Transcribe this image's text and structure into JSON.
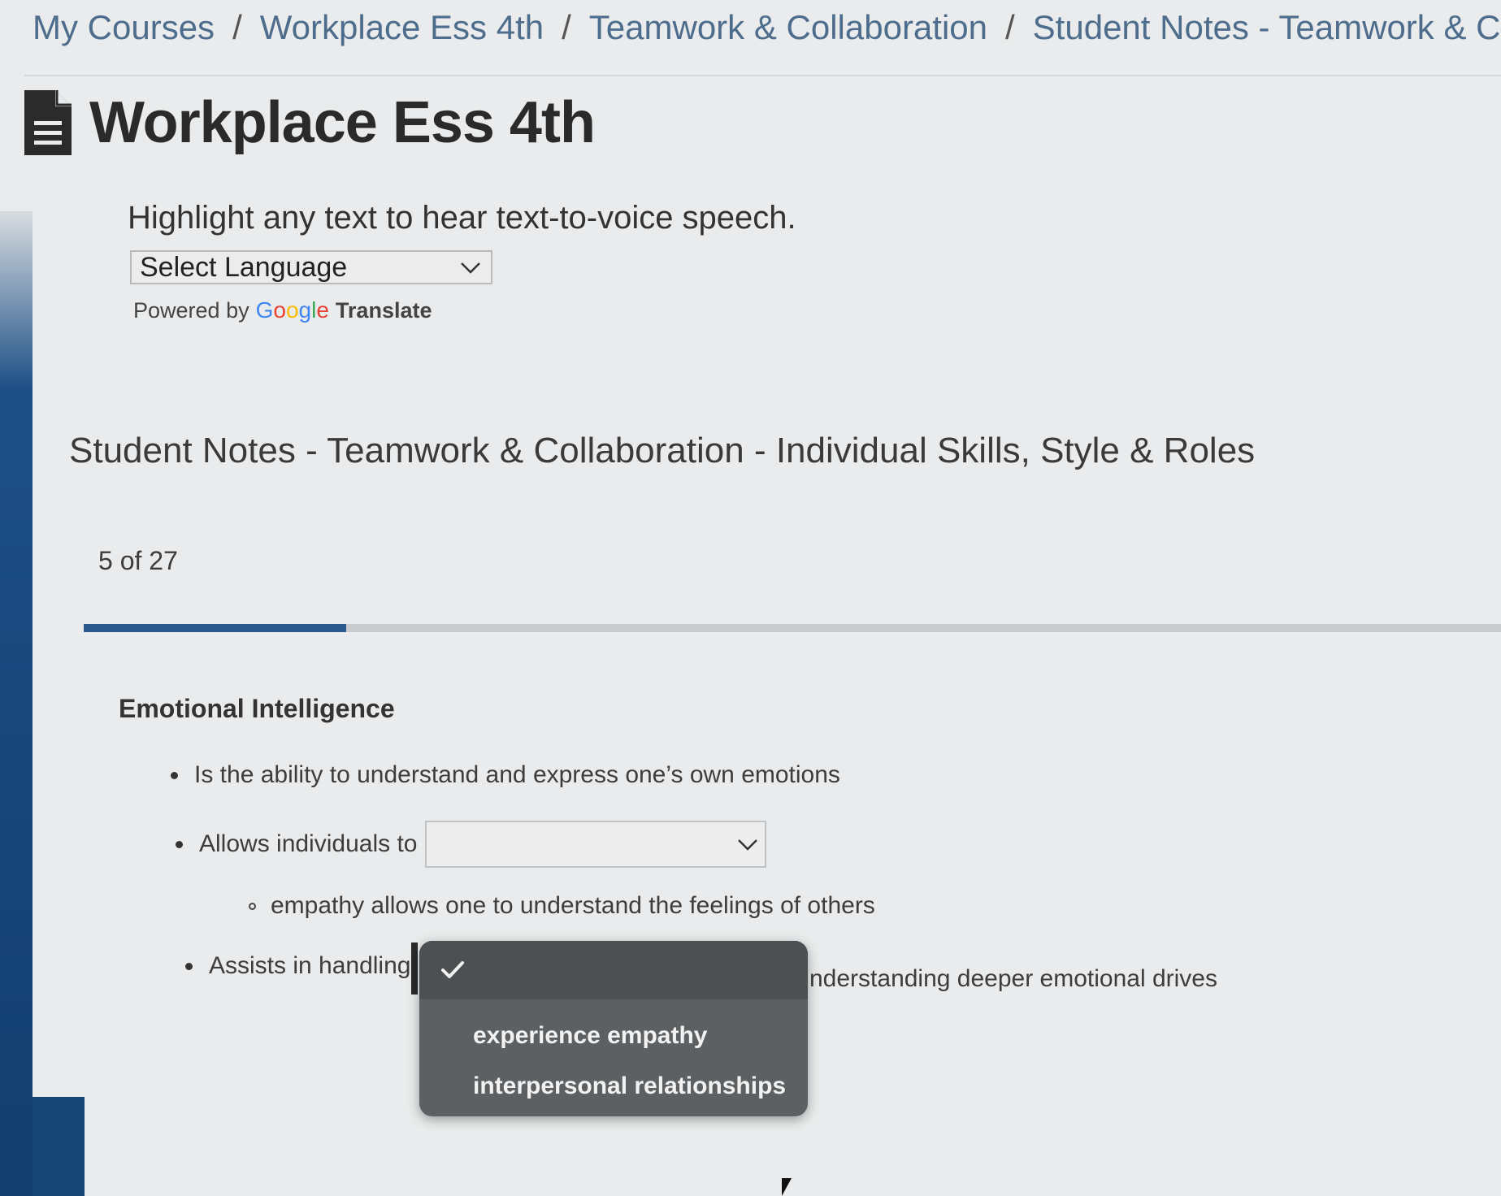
{
  "breadcrumb": {
    "items": [
      {
        "label": "My Courses"
      },
      {
        "label": "Workplace Ess 4th"
      },
      {
        "label": "Teamwork & Collaboration"
      },
      {
        "label": "Student Notes - Teamwork & Collabora"
      }
    ],
    "separator": "/"
  },
  "course": {
    "title": "Workplace Ess 4th",
    "icon": "document-icon"
  },
  "translate": {
    "hint": "Highlight any text to hear text-to-voice speech.",
    "select_label": "Select Language",
    "powered_by": "Powered by",
    "google_letters": [
      "G",
      "o",
      "o",
      "g",
      "l",
      "e"
    ],
    "translate_label": "Translate"
  },
  "lesson": {
    "title": "Student Notes - Teamwork & Collaboration - Individual Skills, Style & Roles",
    "page_indicator": "5 of 27",
    "progress": {
      "current": 5,
      "total": 27
    }
  },
  "content": {
    "heading": "Emotional Intelligence",
    "bullet_1": "Is the ability to understand and express one’s own emotions",
    "bullet_2_prefix": "Allows individuals to",
    "sub_bullet": "empathy allows one to understand the feelings of others",
    "bullet_3_prefix": "Assists in handling",
    "bullet_3_suffix": "nderstanding deeper emotional drives"
  },
  "dropdown": {
    "options": [
      "experience empathy",
      "interpersonal relationships"
    ],
    "selected_icon": "checkmark-icon"
  },
  "colors": {
    "accent": "#2d5a8c",
    "rail": "#174574",
    "dropdown_bg": "#5d6062"
  }
}
